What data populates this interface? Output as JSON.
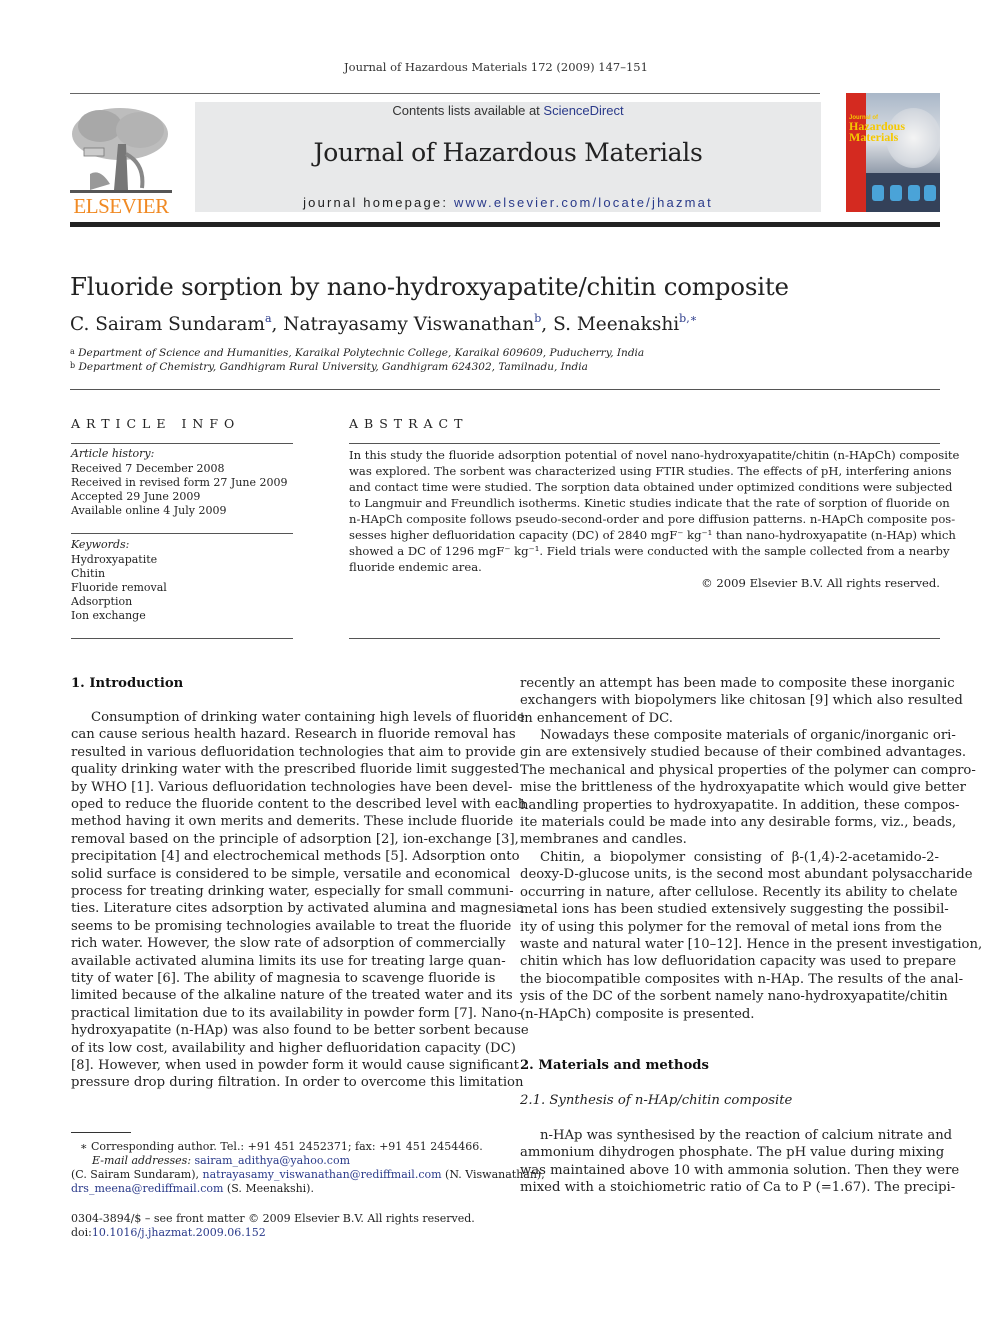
{
  "running_head": "Journal of Hazardous Materials 172 (2009) 147–151",
  "masthead": {
    "contents_prefix": "Contents lists available at ",
    "contents_link": "ScienceDirect",
    "journal_name": "Journal of Hazardous Materials",
    "homepage_prefix": "journal homepage: ",
    "homepage_link": "www.elsevier.com/locate/jhazmat",
    "publisher_logo_text": "ELSEVIER",
    "cover_title_small": "Journal of",
    "cover_title_line1": "Hazardous",
    "cover_title_line2": "Materials",
    "colors": {
      "elsevier_orange": "#f08a24",
      "link_blue": "#2a3a8a",
      "cover_red": "#d42a20",
      "cover_yellow": "#f5c800",
      "box_gray": "#e8e9ea"
    }
  },
  "article": {
    "title": "Fluoride sorption by nano-hydroxyapatite/chitin composite",
    "authors": [
      {
        "name": "C. Sairam Sundaram",
        "sup": "a"
      },
      {
        "name": "Natrayasamy Viswanathan",
        "sup": "b"
      },
      {
        "name": "S. Meenakshi",
        "sup": "b,∗"
      }
    ],
    "affiliations": [
      {
        "sup": "a",
        "text": "Department of Science and Humanities, Karaikal Polytechnic College, Karaikal 609609, Puducherry, India"
      },
      {
        "sup": "b",
        "text": "Department of Chemistry, Gandhigram Rural University, Gandhigram 624302, Tamilnadu, India"
      }
    ]
  },
  "article_info": {
    "heading": "ARTICLE INFO",
    "history_label": "Article history:",
    "history": [
      "Received 7 December 2008",
      "Received in revised form 27 June 2009",
      "Accepted 29 June 2009",
      "Available online 4 July 2009"
    ],
    "keywords_label": "Keywords:",
    "keywords": [
      "Hydroxyapatite",
      "Chitin",
      "Fluoride removal",
      "Adsorption",
      "Ion exchange"
    ]
  },
  "abstract": {
    "heading": "ABSTRACT",
    "lines": [
      "In this study the fluoride adsorption potential of novel nano-hydroxyapatite/chitin (n-HApCh) composite",
      "was explored. The sorbent was characterized using FTIR studies. The effects of pH, interfering anions",
      "and contact time were studied. The sorption data obtained under optimized conditions were subjected",
      "to Langmuir and Freundlich isotherms. Kinetic studies indicate that the rate of sorption of fluoride on",
      "n-HApCh composite follows pseudo-second-order and pore diffusion patterns. n-HApCh composite pos-",
      "sesses higher defluoridation capacity (DC) of 2840 mgF⁻ kg⁻¹ than nano-hydroxyapatite (n-HAp) which",
      "showed a DC of 1296 mgF⁻ kg⁻¹. Field trials were conducted with the sample collected from a nearby",
      "fluoride endemic area."
    ],
    "copyright": "© 2009 Elsevier B.V. All rights reserved."
  },
  "intro": {
    "heading": "1.  Introduction",
    "lines": [
      "Consumption of drinking water containing high levels of fluoride",
      "can cause serious health hazard. Research in fluoride removal has",
      "resulted in various defluoridation technologies that aim to provide",
      "quality drinking water with the prescribed fluoride limit suggested",
      "by WHO [1]. Various defluoridation technologies have been devel-",
      "oped to reduce the fluoride content to the described level with each",
      "method having it own merits and demerits. These include fluoride",
      "removal based on the principle of adsorption [2], ion-exchange [3],",
      "precipitation [4] and electrochemical methods [5]. Adsorption onto",
      "solid surface is considered to be simple, versatile and economical",
      "process for treating drinking water, especially for small communi-",
      "ties. Literature cites adsorption by activated alumina and magnesia",
      "seems to be promising technologies available to treat the fluoride",
      "rich water. However, the slow rate of adsorption of commercially",
      "available activated alumina limits its use for treating large quan-",
      "tity of water [6]. The ability of magnesia to scavenge fluoride is",
      "limited because of the alkaline nature of the treated water and its",
      "practical limitation due to its availability in powder form [7]. Nano-",
      "hydroxyapatite (n-HAp) was also found to be better sorbent because",
      "of its low cost, availability and higher defluoridation capacity (DC)",
      "[8]. However, when used in powder form it would cause significant",
      "pressure drop during filtration. In order to overcome this limitation"
    ]
  },
  "col2": {
    "para1": [
      "recently an attempt has been made to composite these inorganic",
      "exchangers with biopolymers like chitosan [9] which also resulted",
      "in enhancement of DC."
    ],
    "para2": [
      "Nowadays these composite materials of organic/inorganic ori-",
      "gin are extensively studied because of their combined advantages.",
      "The mechanical and physical properties of the polymer can compro-",
      "mise the brittleness of the hydroxyapatite which would give better",
      "handling properties to hydroxyapatite. In addition, these compos-",
      "ite materials could be made into any desirable forms, viz., beads,",
      "membranes and candles."
    ],
    "para3": [
      "Chitin, a biopolymer consisting of β-(1,4)-2-acetamido-2-",
      "deoxy-D-glucose units, is the second most abundant polysaccharide",
      "occurring in nature, after cellulose. Recently its ability to chelate",
      "metal ions has been studied extensively suggesting the possibil-",
      "ity of using this polymer for the removal of metal ions from the",
      "waste and natural water [10–12]. Hence in the present investigation,",
      "chitin which has low defluoridation capacity was used to prepare",
      "the biocompatible composites with n-HAp. The results of the anal-",
      "ysis of the DC of the sorbent namely nano-hydroxyapatite/chitin",
      "(n-HApCh) composite is presented."
    ],
    "section2_heading": "2.  Materials and methods",
    "subsection_heading": "2.1.  Synthesis of n-HAp/chitin composite",
    "para4": [
      "n-HAp was synthesised by the reaction of calcium nitrate and",
      "ammonium dihydrogen phosphate. The pH value during mixing",
      "was maintained above 10 with ammonia solution. Then they were",
      "mixed with a stoichiometric ratio of Ca to P (=1.67). The precipi-"
    ]
  },
  "footnotes": {
    "corresponding": "∗   Corresponding author. Tel.: +91 451 2452371; fax: +91 451 2454466.",
    "email_label": "E-mail addresses: ",
    "emails": [
      {
        "address": "sairam_adithya@yahoo.com",
        "owner": "(C. Sairam Sundaram), "
      },
      {
        "address": "natrayasamy_viswanathan@rediffmail.com",
        "owner": " (N. Viswanathan),"
      },
      {
        "address": "drs_meena@rediffmail.com",
        "owner": " (S. Meenakshi)."
      }
    ],
    "issn": "0304-3894/$ – see front matter © 2009 Elsevier B.V. All rights reserved.",
    "doi_label": "doi:",
    "doi": "10.1016/j.jhazmat.2009.06.152"
  }
}
